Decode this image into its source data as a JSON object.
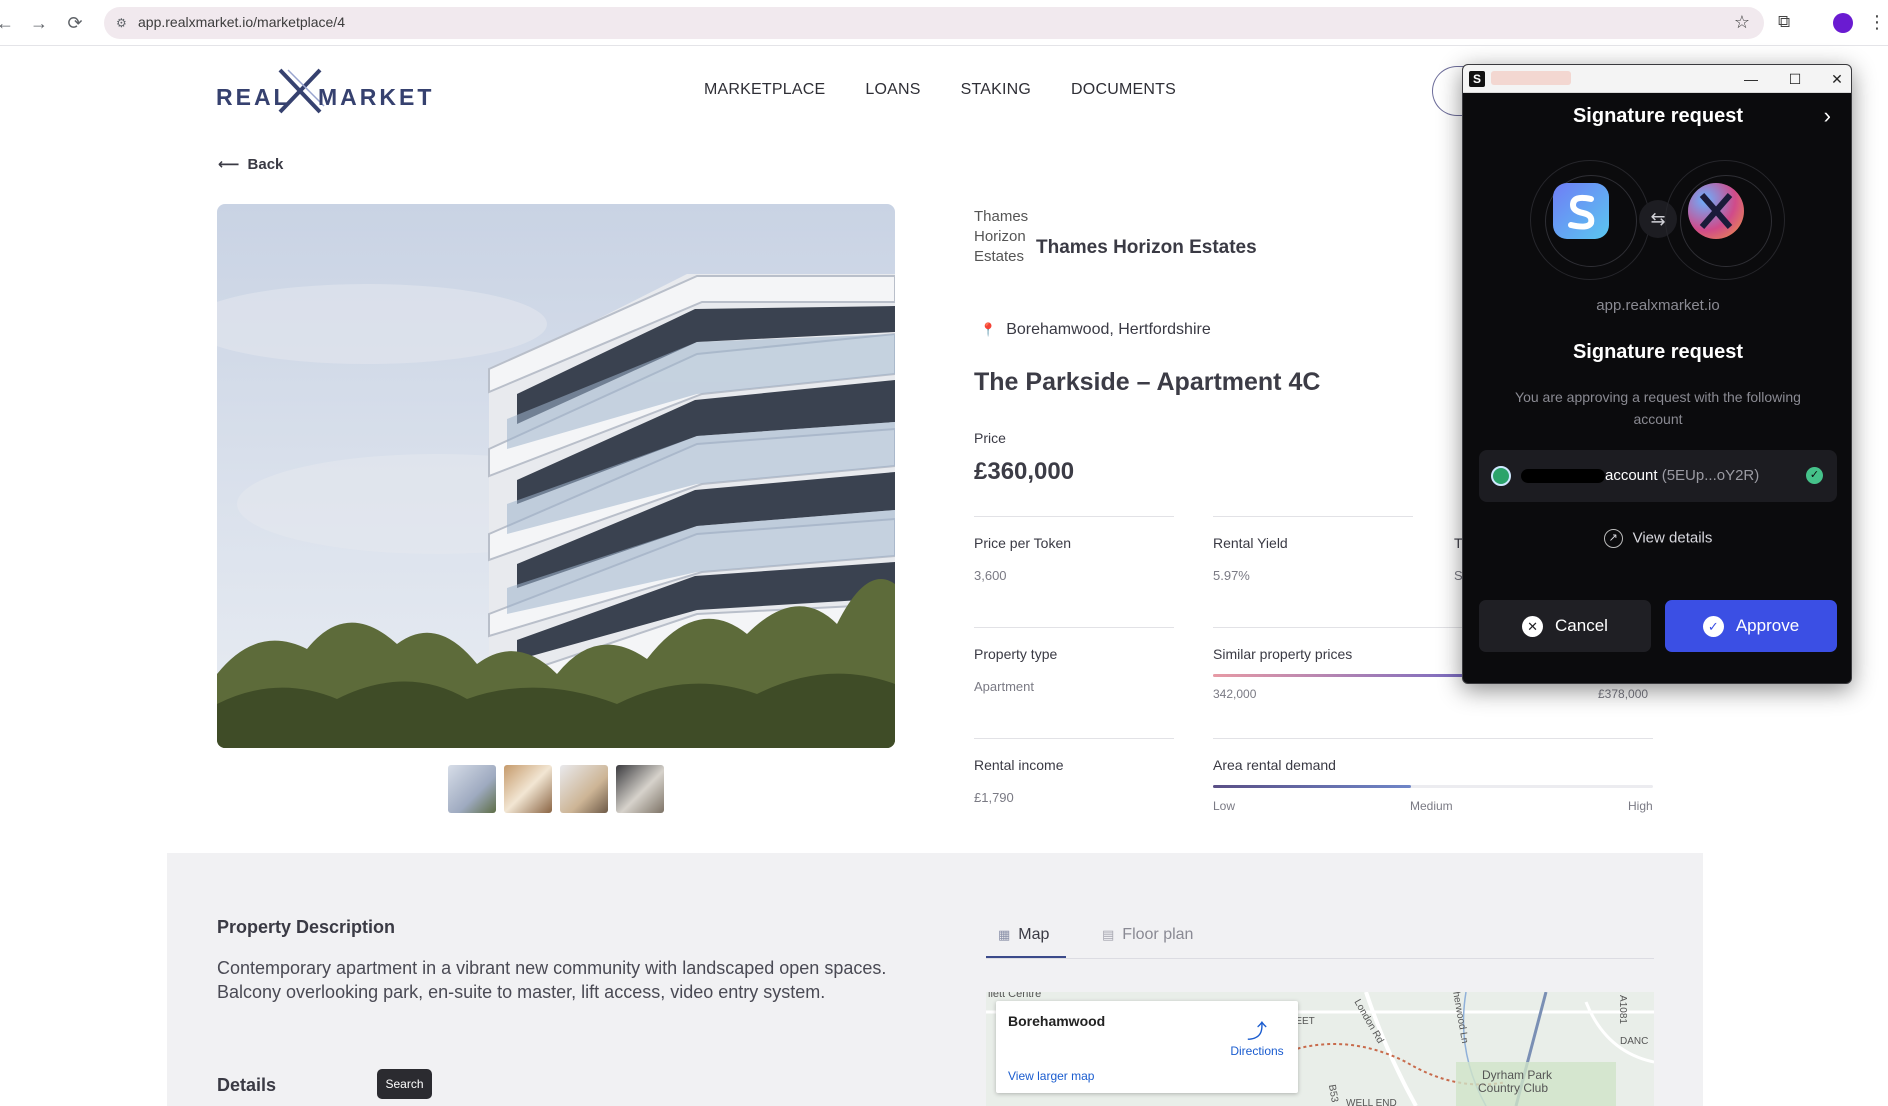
{
  "browser": {
    "url": "app.realxmarket.io/marketplace/4",
    "back_glyph": "←",
    "forward_glyph": "→",
    "reload_glyph": "⟳"
  },
  "site": {
    "logo_left": "REAL",
    "logo_right": "MARKET",
    "nav": [
      "MARKETPLACE",
      "LOANS",
      "STAKING",
      "DOCUMENTS"
    ],
    "back_label": "Back"
  },
  "property": {
    "company_logo_alt": "Thames Horizon Estates",
    "company_name": "Thames Horizon Estates",
    "location": "Borehamwood, Hertfordshire",
    "title": "The Parkside – Apartment 4C",
    "price_label": "Price",
    "price_value": "£360,000",
    "stats": {
      "price_per_token_label": "Price per Token",
      "price_per_token_value": "3,600",
      "rental_yield_label": "Rental Yield",
      "rental_yield_value": "5.97%",
      "partial_label": "T",
      "partial_value": "S",
      "property_type_label": "Property type",
      "property_type_value": "Apartment",
      "similar_prices_label": "Similar property prices",
      "similar_prices_min": "342,000",
      "similar_prices_max": "£378,000",
      "rental_income_label": "Rental income",
      "rental_income_value": "£1,790",
      "demand_label": "Area rental demand",
      "demand_low": "Low",
      "demand_medium": "Medium",
      "demand_high": "High",
      "demand_level": 0.45
    },
    "description_heading": "Property Description",
    "description": "Contemporary apartment in a vibrant new community with landscaped open spaces. Balcony overlooking park, en-suite to master, lift access, video entry system.",
    "details_heading": "Details",
    "tooltip": "Search"
  },
  "tabs": [
    {
      "label": "Map",
      "active": true
    },
    {
      "label": "Floor plan",
      "active": false
    }
  ],
  "map": {
    "place": "Borehamwood",
    "directions": "Directions",
    "larger_map": "View larger map",
    "labels": [
      "llett Centre",
      "TREET",
      "London Rd",
      "herwood Ln",
      "A1081",
      "DANC",
      "Dyrham Park",
      "Country Club",
      "B53",
      "WELL END"
    ]
  },
  "wallet": {
    "header_title": "Signature request",
    "origin": "app.realxmarket.io",
    "body_title": "Signature request",
    "subtitle": "You are approving a request with the following account",
    "account_name": "account",
    "account_address": "(5EUp...oY2R)",
    "view_details": "View details",
    "cancel_label": "Cancel",
    "approve_label": "Approve"
  },
  "colors": {
    "brand_navy": "#36416f",
    "approve_blue": "#3b4fe4",
    "check_green": "#45c28a"
  }
}
